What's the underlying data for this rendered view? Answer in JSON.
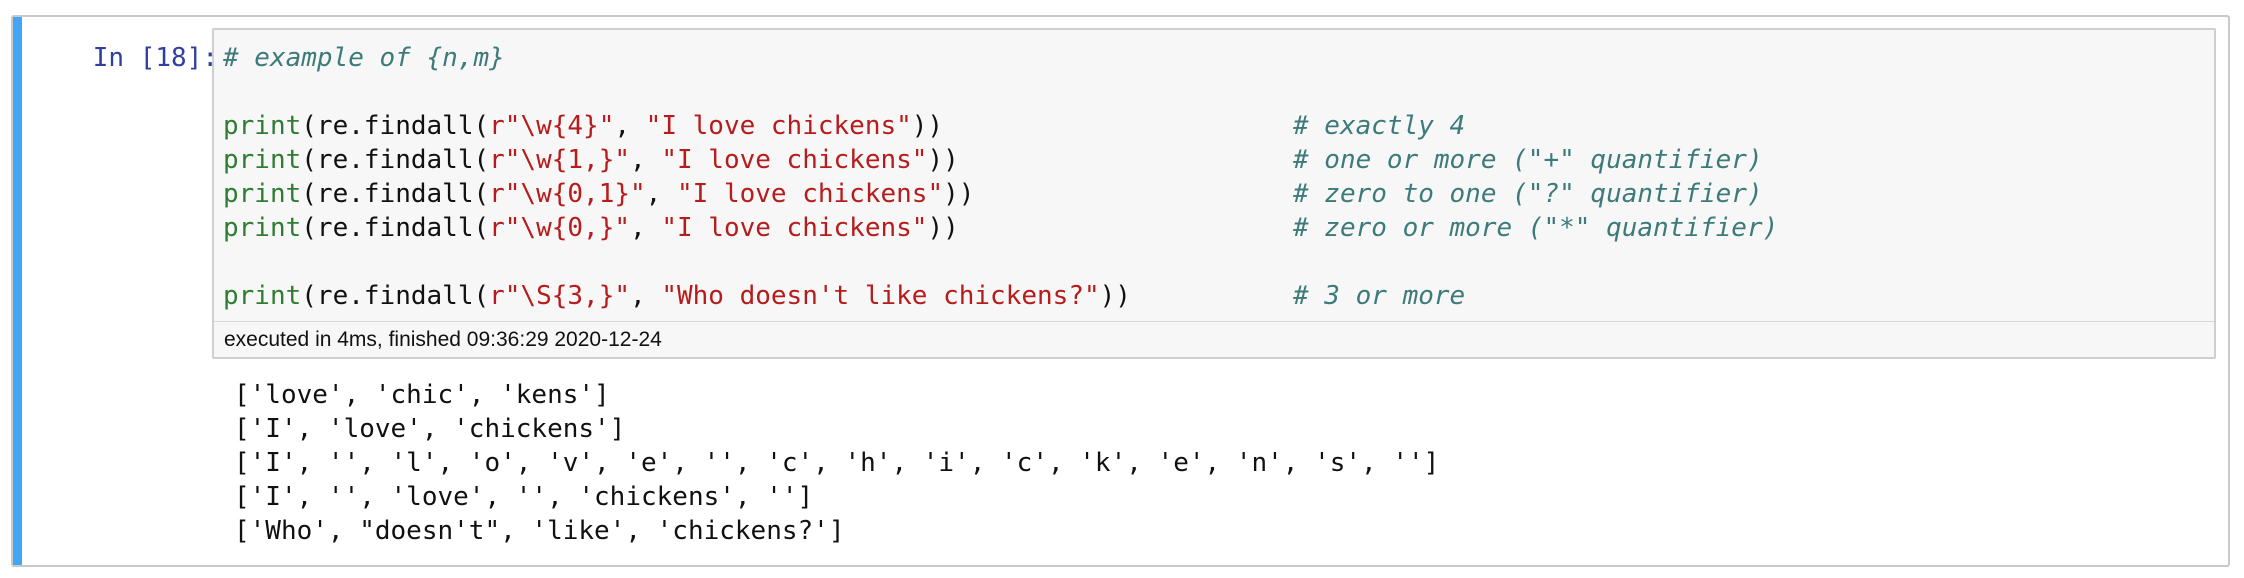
{
  "cell": {
    "prompt": "In [18]:",
    "accent_color": "#42a5f5",
    "header_comment": "# example of {n,m}",
    "code_lines": [
      {
        "fn": "print",
        "pre": "(re.findall(",
        "pattern": "r\"\\w{4}\"",
        "mid": ", ",
        "text": "\"I love chickens\"",
        "post": "))",
        "comment": "# exactly 4"
      },
      {
        "fn": "print",
        "pre": "(re.findall(",
        "pattern": "r\"\\w{1,}\"",
        "mid": ", ",
        "text": "\"I love chickens\"",
        "post": "))",
        "comment": "# one or more (\"+\" quantifier)"
      },
      {
        "fn": "print",
        "pre": "(re.findall(",
        "pattern": "r\"\\w{0,1}\"",
        "mid": ", ",
        "text": "\"I love chickens\"",
        "post": "))",
        "comment": "# zero to one (\"?\" quantifier)"
      },
      {
        "fn": "print",
        "pre": "(re.findall(",
        "pattern": "r\"\\w{0,}\"",
        "mid": ", ",
        "text": "\"I love chickens\"",
        "post": "))",
        "comment": "# zero or more (\"*\" quantifier)"
      },
      {
        "fn": "print",
        "pre": "(re.findall(",
        "pattern": "r\"\\S{3,}\"",
        "mid": ", ",
        "text": "\"Who doesn't like chickens?\"",
        "post": "))",
        "comment": "# 3 or more"
      }
    ],
    "execution_info": "executed in 4ms, finished 09:36:29 2020-12-24",
    "output_lines": [
      "['love', 'chic', 'kens']",
      "['I', 'love', 'chickens']",
      "['I', '', 'l', 'o', 'v', 'e', '', 'c', 'h', 'i', 'c', 'k', 'e', 'n', 's', '']",
      "['I', '', 'love', '', 'chickens', '']",
      "['Who', \"doesn't\", 'like', 'chickens?']"
    ]
  }
}
